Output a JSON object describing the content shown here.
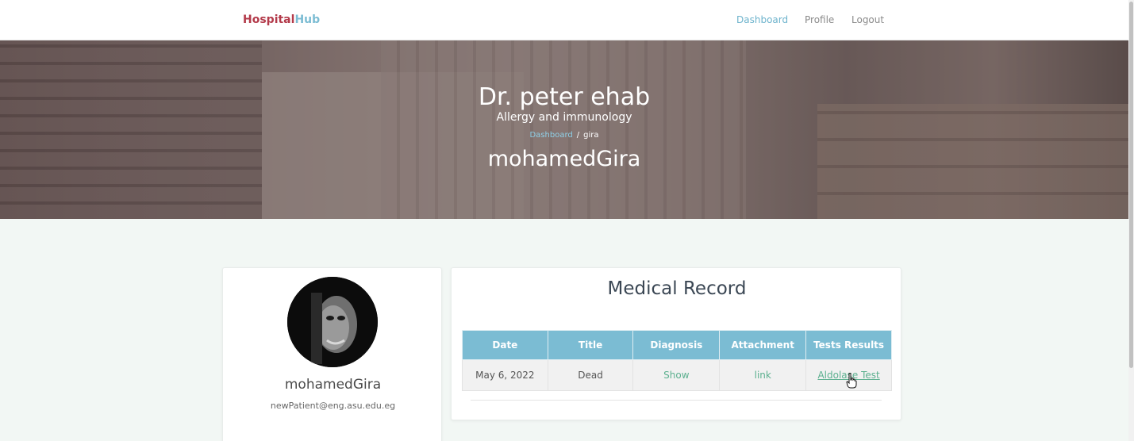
{
  "brand": {
    "part1": "Hospital",
    "part2": "Hub"
  },
  "nav": {
    "dashboard": "Dashboard",
    "profile": "Profile",
    "logout": "Logout"
  },
  "hero": {
    "doctor_name": "Dr. peter ehab",
    "specialty": "Allergy and immunology",
    "breadcrumb": {
      "home": "Dashboard",
      "separator": "/",
      "current": "gira"
    },
    "patient_name": "mohamedGira"
  },
  "profile": {
    "name": "mohamedGira",
    "email": "newPatient@eng.asu.edu.eg"
  },
  "record": {
    "title": "Medical Record",
    "columns": [
      "Date",
      "Title",
      "Diagnosis",
      "Attachment",
      "Tests Results"
    ],
    "rows": [
      {
        "date": "May 6, 2022",
        "title": "Dead",
        "diagnosis": "Show",
        "attachment": "link",
        "tests": "Aldolase Test"
      }
    ]
  },
  "colors": {
    "accent": "#7bbcd3",
    "brand_red": "#b33a4a",
    "link_green": "#5cb08f",
    "page_bg": "#f2f7f4"
  }
}
